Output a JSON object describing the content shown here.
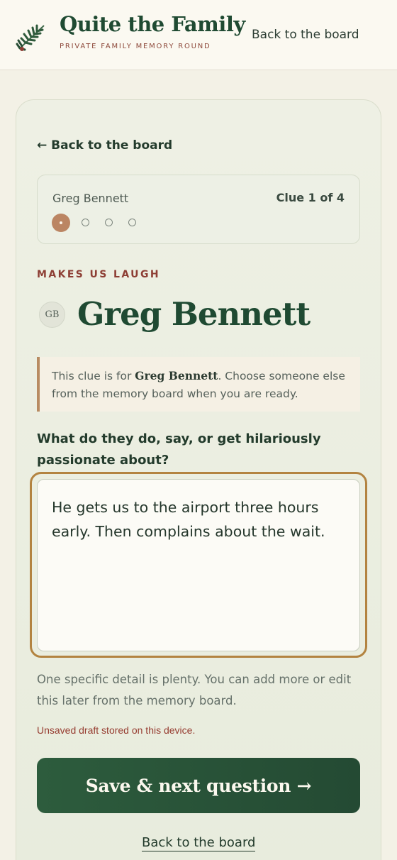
{
  "header": {
    "title": "Quite the Family",
    "subtitle": "PRIVATE FAMILY MEMORY ROUND",
    "nav_link": "Back to the board",
    "logo_icon": "pine-branch-icon"
  },
  "main": {
    "back_link": "← Back to the board",
    "progress": {
      "name": "Greg Bennett",
      "clue_label": "Clue 1 of 4",
      "current": 1,
      "total": 4
    },
    "category": "MAKES US LAUGH",
    "avatar_initials": "GB",
    "person_name": "Greg Bennett",
    "notice": {
      "before": "This clue is for ",
      "name": "Greg Bennett",
      "after": ". Choose someone else from the memory board when you are ready."
    },
    "question": "What do they do, say, or get hilariously passionate about?",
    "answer": "He gets us to the airport three hours early. Then complains about the wait.",
    "hint": "One specific detail is plenty. You can add more or edit this later from the memory board.",
    "draft_status": "Unsaved draft stored on this device.",
    "save_button": "Save & next question →",
    "bottom_link": "Back to the board"
  },
  "colors": {
    "brand_green": "#1f4a32",
    "accent_rust": "#8d3e34",
    "focus_gold": "#b38340",
    "active_dot": "#bb8563"
  }
}
